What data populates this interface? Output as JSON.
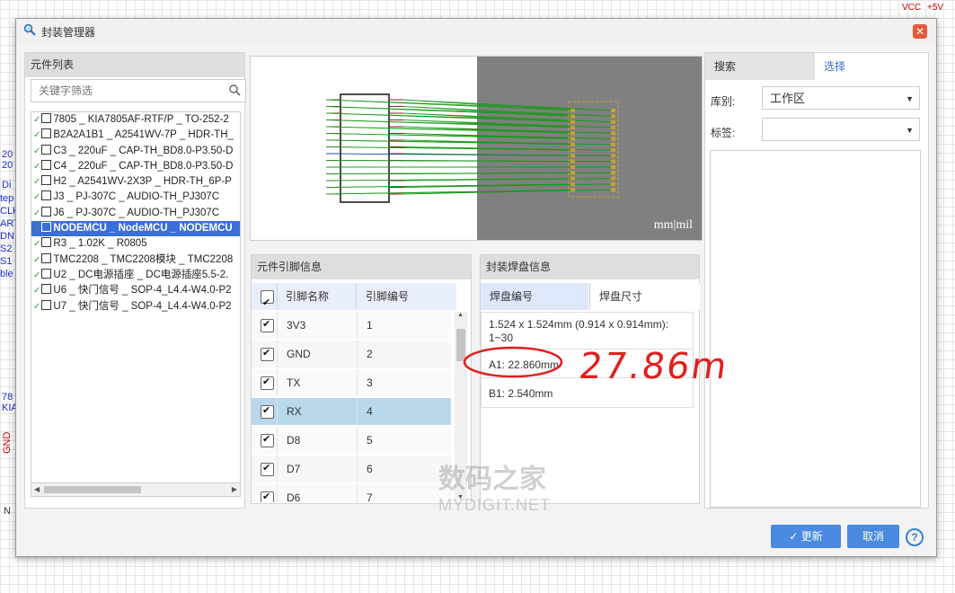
{
  "background": {
    "top_right_labels": [
      "VCC",
      "+5V"
    ],
    "left_fragments": [
      "20",
      "20",
      "Di",
      "tep",
      "CLK",
      "ART",
      "DN",
      "S2",
      "S1",
      "ble"
    ],
    "left_bottom": [
      "78",
      "KIA",
      "GND",
      "N"
    ]
  },
  "dialog": {
    "title": "封装管理器",
    "close_symbol": "✕"
  },
  "component_list": {
    "header": "元件列表",
    "search_placeholder": "关键字筛选",
    "items": [
      {
        "label": "7805 _ KIA7805AF-RTF/P _ TO-252-2",
        "selected": false
      },
      {
        "label": "B2A2A1B1 _ A2541WV-7P _ HDR-TH_",
        "selected": false
      },
      {
        "label": "C3 _ 220uF _ CAP-TH_BD8.0-P3.50-D",
        "selected": false
      },
      {
        "label": "C4 _ 220uF _ CAP-TH_BD8.0-P3.50-D",
        "selected": false
      },
      {
        "label": "H2 _ A2541WV-2X3P _ HDR-TH_6P-P",
        "selected": false
      },
      {
        "label": "J3 _ PJ-307C _ AUDIO-TH_PJ307C",
        "selected": false
      },
      {
        "label": "J6 _ PJ-307C _ AUDIO-TH_PJ307C",
        "selected": false
      },
      {
        "label": "NODEMCU _ NodeMCU _ NODEMCU",
        "selected": true
      },
      {
        "label": "R3 _ 1.02K _ R0805",
        "selected": false
      },
      {
        "label": "TMC2208 _ TMC2208模块 _ TMC2208",
        "selected": false
      },
      {
        "label": "U2 _ DC电源插座 _ DC电源插座5.5-2.",
        "selected": false
      },
      {
        "label": "U6 _ 快门信号 _ SOP-4_L4.4-W4.0-P2",
        "selected": false
      },
      {
        "label": "U7 _ 快门信号 _ SOP-4_L4.4-W4.0-P2",
        "selected": false
      }
    ]
  },
  "preview": {
    "unit_label": "mm|mil"
  },
  "pin_info": {
    "header": "元件引脚信息",
    "col_name": "引脚名称",
    "col_number": "引脚编号",
    "rows": [
      {
        "name": "3V3",
        "number": "1",
        "selected": false
      },
      {
        "name": "GND",
        "number": "2",
        "selected": false
      },
      {
        "name": "TX",
        "number": "3",
        "selected": false
      },
      {
        "name": "RX",
        "number": "4",
        "selected": true
      },
      {
        "name": "D8",
        "number": "5",
        "selected": false
      },
      {
        "name": "D7",
        "number": "6",
        "selected": false
      },
      {
        "name": "D6",
        "number": "7",
        "selected": false
      }
    ]
  },
  "pad_info": {
    "header": "封装焊盘信息",
    "tab_number": "焊盘编号",
    "tab_size": "焊盘尺寸",
    "entries": [
      "1.524 x 1.524mm (0.914 x 0.914mm):",
      "1~30",
      "A1: 22.860mm",
      "B1: 2.540mm"
    ]
  },
  "right_panel": {
    "tab_search": "搜索",
    "tab_select": "选择",
    "library_label": "库别:",
    "library_value": "工作区",
    "tag_label": "标签:",
    "tag_value": ""
  },
  "buttons": {
    "update": "更新",
    "cancel": "取消",
    "help": "?"
  },
  "annotation": {
    "handwritten": "27.86m"
  },
  "watermark": {
    "cn": "数码之家",
    "en": "MYDIGIT.NET"
  }
}
